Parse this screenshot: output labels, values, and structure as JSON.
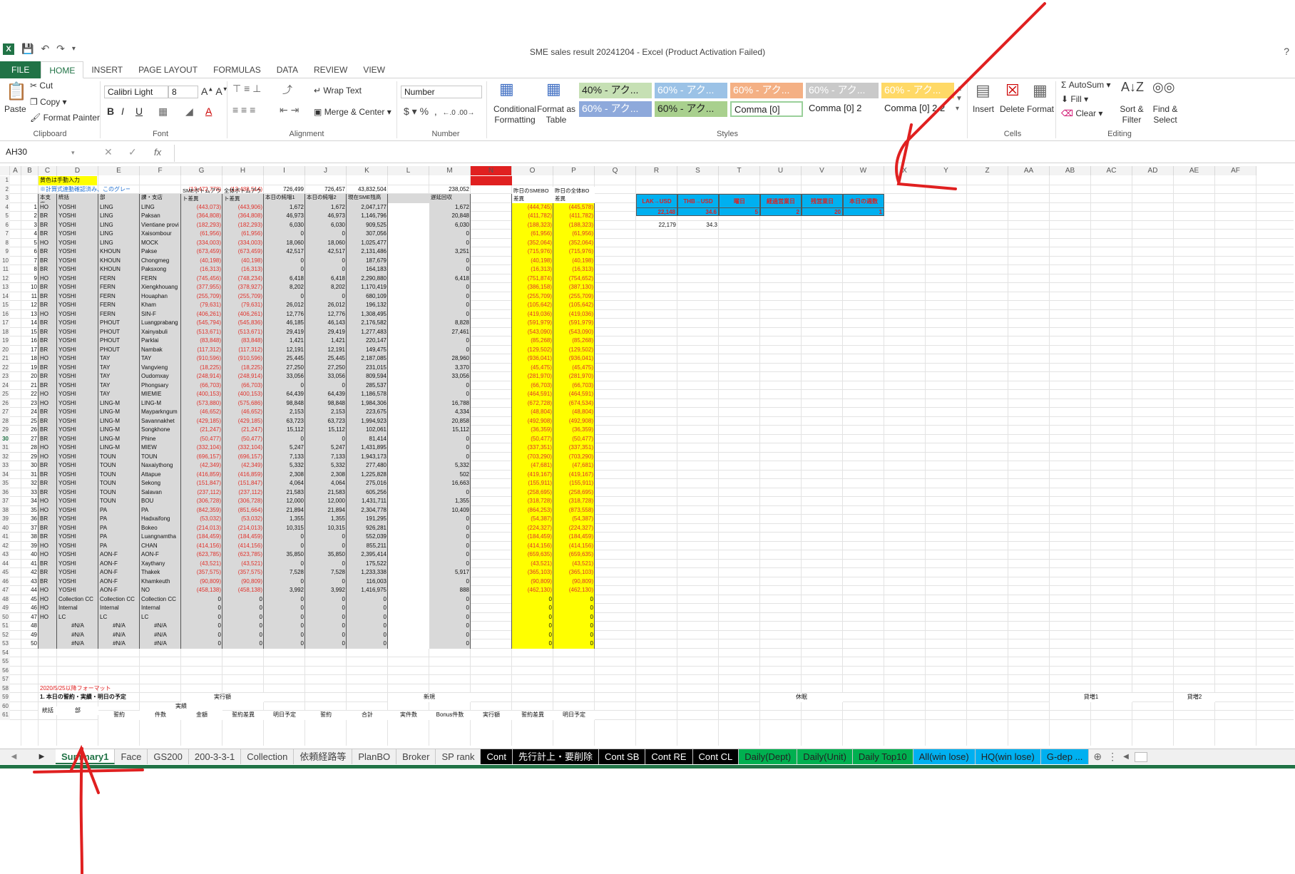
{
  "window": {
    "title": "SME sales result 20241204 - Excel (Product Activation Failed)",
    "help": "?"
  },
  "ribbon_tabs": [
    "FILE",
    "HOME",
    "INSERT",
    "PAGE LAYOUT",
    "FORMULAS",
    "DATA",
    "REVIEW",
    "VIEW"
  ],
  "clipboard": {
    "paste": "Paste",
    "cut": "Cut",
    "copy": "Copy",
    "format_painter": "Format Painter",
    "label": "Clipboard"
  },
  "font": {
    "name": "Calibri Light",
    "size": "8",
    "label": "Font"
  },
  "alignment": {
    "wrap": "Wrap Text",
    "merge": "Merge & Center",
    "label": "Alignment"
  },
  "number": {
    "format": "Number",
    "label": "Number"
  },
  "styles": {
    "conditional": "Conditional Formatting",
    "format_table": "Format as Table",
    "label": "Styles",
    "cells": [
      {
        "text": "40% - アク...",
        "bg": "#c6e0b4"
      },
      {
        "text": "60% - アク...",
        "bg": "#9bc2e6"
      },
      {
        "text": "60% - アク...",
        "bg": "#f4b084"
      },
      {
        "text": "60% - アク...",
        "bg": "#c9c9c9"
      },
      {
        "text": "60% - アク...",
        "bg": "#ffd966"
      },
      {
        "text": "60% - アク...",
        "bg": "#8ea9db"
      },
      {
        "text": "60% - アク...",
        "bg": "#a9d08e"
      },
      {
        "text": "Comma [0]",
        "bg": "#ffffff"
      },
      {
        "text": "Comma [0] 2",
        "bg": "#ffffff"
      },
      {
        "text": "Comma [0] 2 2",
        "bg": "#ffffff"
      }
    ]
  },
  "cells_group": {
    "insert": "Insert",
    "delete": "Delete",
    "format": "Format",
    "label": "Cells"
  },
  "editing": {
    "autosum": "AutoSum",
    "fill": "Fill",
    "clear": "Clear",
    "sort": "Sort & Filter",
    "find": "Find & Select",
    "label": "Editing"
  },
  "formula_bar": {
    "name_box": "AH30",
    "fx": "fx",
    "content": ""
  },
  "columns": [
    "A",
    "B",
    "C",
    "D",
    "E",
    "F",
    "G",
    "H",
    "I",
    "J",
    "K",
    "L",
    "M",
    "N",
    "O",
    "P",
    "Q",
    "R",
    "S",
    "T",
    "U",
    "V",
    "W",
    "X",
    "Y",
    "Z",
    "AA",
    "AB",
    "AC",
    "AD",
    "AE",
    "AF"
  ],
  "sheet": {
    "r1_note": "黄色は手動入力",
    "r2_note": "※計算式連動確認済み、このグレー部分はいつ削除して",
    "r2_vals": {
      "G": "(13,472,778)",
      "H": "(13,488,514)",
      "I": "726,499",
      "J": "726,457",
      "K": "43,832,504",
      "M": "238,052",
      "O": "(14,199,276)",
      "P": "(14,214,970)"
    },
    "headers": {
      "C": "本支店",
      "D": "統括",
      "E": "部",
      "F": "課・支店",
      "G": "SMEボトムアウト差異",
      "H": "全体ボトムアウト差異",
      "I": "本日の純増1",
      "J": "本日の純増2",
      "K": "現在SME残高",
      "M": "遅延回収",
      "O": "昨日のSMEBO差異",
      "P": "昨日の全体BO差異"
    },
    "kpi_headers": [
      "LAK→USD",
      "THB→USD",
      "曜日",
      "経過営業日",
      "残営業日",
      "本日の週数"
    ],
    "kpi_values": [
      "22,148",
      "34.6",
      "5",
      "2",
      "20",
      "1"
    ],
    "r6_vals": [
      "22,179",
      "34.3"
    ],
    "rows": [
      [
        "1",
        "HO",
        "YOSHI",
        "LING",
        "LING",
        "(443,073)",
        "(443,906)",
        "1,672",
        "1,672",
        "2,047,177",
        "1,672",
        "(444,745)",
        "(445,578)"
      ],
      [
        "2",
        "BR",
        "YOSHI",
        "LING",
        "Paksan",
        "(364,808)",
        "(364,808)",
        "46,973",
        "46,973",
        "1,146,796",
        "20,848",
        "(411,782)",
        "(411,782)"
      ],
      [
        "3",
        "BR",
        "YOSHI",
        "LING",
        "Vientiane provi",
        "(182,293)",
        "(182,293)",
        "6,030",
        "6,030",
        "909,525",
        "6,030",
        "(188,323)",
        "(188,323)"
      ],
      [
        "4",
        "BR",
        "YOSHI",
        "LING",
        "Xaisombour",
        "(61,956)",
        "(61,956)",
        "0",
        "0",
        "307,056",
        "0",
        "(61,956)",
        "(61,956)"
      ],
      [
        "5",
        "HO",
        "YOSHI",
        "LING",
        "MOCK",
        "(334,003)",
        "(334,003)",
        "18,060",
        "18,060",
        "1,025,477",
        "0",
        "(352,064)",
        "(352,064)"
      ],
      [
        "6",
        "BR",
        "YOSHI",
        "KHOUN",
        "Pakse",
        "(673,459)",
        "(673,459)",
        "42,517",
        "42,517",
        "2,131,486",
        "3,251",
        "(715,976)",
        "(715,976)"
      ],
      [
        "7",
        "BR",
        "YOSHI",
        "KHOUN",
        "Chongmeg",
        "(40,198)",
        "(40,198)",
        "0",
        "0",
        "187,679",
        "0",
        "(40,198)",
        "(40,198)"
      ],
      [
        "8",
        "BR",
        "YOSHI",
        "KHOUN",
        "Paksxong",
        "(16,313)",
        "(16,313)",
        "0",
        "0",
        "164,183",
        "0",
        "(16,313)",
        "(16,313)"
      ],
      [
        "9",
        "HO",
        "YOSHI",
        "FERN",
        "FERN",
        "(745,456)",
        "(748,234)",
        "6,418",
        "6,418",
        "2,290,880",
        "6,418",
        "(751,874)",
        "(754,652)"
      ],
      [
        "10",
        "BR",
        "YOSHI",
        "FERN",
        "Xiengkhouang",
        "(377,955)",
        "(378,927)",
        "8,202",
        "8,202",
        "1,170,419",
        "0",
        "(386,158)",
        "(387,130)"
      ],
      [
        "11",
        "BR",
        "YOSHI",
        "FERN",
        "Houaphan",
        "(255,709)",
        "(255,709)",
        "0",
        "0",
        "680,109",
        "0",
        "(255,709)",
        "(255,709)"
      ],
      [
        "12",
        "BR",
        "YOSHI",
        "FERN",
        "Kham",
        "(79,631)",
        "(79,631)",
        "26,012",
        "26,012",
        "196,132",
        "0",
        "(105,642)",
        "(105,642)"
      ],
      [
        "13",
        "HO",
        "YOSHI",
        "FERN",
        "SIN-F",
        "(406,261)",
        "(406,261)",
        "12,776",
        "12,776",
        "1,308,495",
        "0",
        "(419,036)",
        "(419,036)"
      ],
      [
        "14",
        "BR",
        "YOSHI",
        "PHOUT",
        "Luangprabang",
        "(545,794)",
        "(545,836)",
        "46,185",
        "46,143",
        "2,176,582",
        "8,828",
        "(591,979)",
        "(591,979)"
      ],
      [
        "15",
        "BR",
        "YOSHI",
        "PHOUT",
        "Xainyabuli",
        "(513,671)",
        "(513,671)",
        "29,419",
        "29,419",
        "1,277,483",
        "27,461",
        "(543,090)",
        "(543,090)"
      ],
      [
        "16",
        "BR",
        "YOSHI",
        "PHOUT",
        "Parklai",
        "(83,848)",
        "(83,848)",
        "1,421",
        "1,421",
        "220,147",
        "0",
        "(85,268)",
        "(85,268)"
      ],
      [
        "17",
        "BR",
        "YOSHI",
        "PHOUT",
        "Nambak",
        "(117,312)",
        "(117,312)",
        "12,191",
        "12,191",
        "149,475",
        "0",
        "(129,502)",
        "(129,502)"
      ],
      [
        "18",
        "HO",
        "YOSHI",
        "TAY",
        "TAY",
        "(910,596)",
        "(910,596)",
        "25,445",
        "25,445",
        "2,187,085",
        "28,960",
        "(936,041)",
        "(936,041)"
      ],
      [
        "19",
        "BR",
        "YOSHI",
        "TAY",
        "Vangvieng",
        "(18,225)",
        "(18,225)",
        "27,250",
        "27,250",
        "231,015",
        "3,370",
        "(45,475)",
        "(45,475)"
      ],
      [
        "20",
        "BR",
        "YOSHI",
        "TAY",
        "Oudomxay",
        "(248,914)",
        "(248,914)",
        "33,056",
        "33,056",
        "809,594",
        "33,056",
        "(281,970)",
        "(281,970)"
      ],
      [
        "21",
        "BR",
        "YOSHI",
        "TAY",
        "Phongsary",
        "(66,703)",
        "(66,703)",
        "0",
        "0",
        "285,537",
        "0",
        "(66,703)",
        "(66,703)"
      ],
      [
        "22",
        "HO",
        "YOSHI",
        "TAY",
        "MIEMIE",
        "(400,153)",
        "(400,153)",
        "64,439",
        "64,439",
        "1,186,578",
        "0",
        "(464,591)",
        "(464,591)"
      ],
      [
        "23",
        "HO",
        "YOSHI",
        "LING-M",
        "LING-M",
        "(573,880)",
        "(575,686)",
        "98,848",
        "98,848",
        "1,984,306",
        "16,788",
        "(672,728)",
        "(674,534)"
      ],
      [
        "24",
        "BR",
        "YOSHI",
        "LING-M",
        "Mayparkngum",
        "(46,652)",
        "(46,652)",
        "2,153",
        "2,153",
        "223,675",
        "4,334",
        "(48,804)",
        "(48,804)"
      ],
      [
        "25",
        "BR",
        "YOSHI",
        "LING-M",
        "Savannakhet",
        "(429,185)",
        "(429,185)",
        "63,723",
        "63,723",
        "1,994,923",
        "20,858",
        "(492,908)",
        "(492,908)"
      ],
      [
        "26",
        "BR",
        "YOSHI",
        "LING-M",
        "Songkhone",
        "(21,247)",
        "(21,247)",
        "15,112",
        "15,112",
        "102,061",
        "15,112",
        "(36,359)",
        "(36,359)"
      ],
      [
        "27",
        "BR",
        "YOSHI",
        "LING-M",
        "Phine",
        "(50,477)",
        "(50,477)",
        "0",
        "0",
        "81,414",
        "0",
        "(50,477)",
        "(50,477)"
      ],
      [
        "28",
        "HO",
        "YOSHI",
        "LING-M",
        "MIEW",
        "(332,104)",
        "(332,104)",
        "5,247",
        "5,247",
        "1,431,895",
        "0",
        "(337,351)",
        "(337,351)"
      ],
      [
        "29",
        "HO",
        "YOSHI",
        "TOUN",
        "TOUN",
        "(696,157)",
        "(696,157)",
        "7,133",
        "7,133",
        "1,943,173",
        "0",
        "(703,290)",
        "(703,290)"
      ],
      [
        "30",
        "BR",
        "YOSHI",
        "TOUN",
        "Naxaiythong",
        "(42,349)",
        "(42,349)",
        "5,332",
        "5,332",
        "277,480",
        "5,332",
        "(47,681)",
        "(47,681)"
      ],
      [
        "31",
        "BR",
        "YOSHI",
        "TOUN",
        "Attapue",
        "(416,859)",
        "(416,859)",
        "2,308",
        "2,308",
        "1,225,828",
        "502",
        "(419,167)",
        "(419,167)"
      ],
      [
        "32",
        "BR",
        "YOSHI",
        "TOUN",
        "Sekong",
        "(151,847)",
        "(151,847)",
        "4,064",
        "4,064",
        "275,016",
        "16,663",
        "(155,911)",
        "(155,911)"
      ],
      [
        "33",
        "BR",
        "YOSHI",
        "TOUN",
        "Salavan",
        "(237,112)",
        "(237,112)",
        "21,583",
        "21,583",
        "605,256",
        "0",
        "(258,695)",
        "(258,695)"
      ],
      [
        "34",
        "HO",
        "YOSHI",
        "TOUN",
        "BOU",
        "(306,728)",
        "(306,728)",
        "12,000",
        "12,000",
        "1,431,711",
        "1,355",
        "(318,728)",
        "(318,728)"
      ],
      [
        "35",
        "HO",
        "YOSHI",
        "PA",
        "PA",
        "(842,359)",
        "(851,664)",
        "21,894",
        "21,894",
        "2,304,778",
        "10,409",
        "(864,253)",
        "(873,558)"
      ],
      [
        "36",
        "BR",
        "YOSHI",
        "PA",
        "Hadxaifong",
        "(53,032)",
        "(53,032)",
        "1,355",
        "1,355",
        "191,295",
        "0",
        "(54,387)",
        "(54,387)"
      ],
      [
        "37",
        "BR",
        "YOSHI",
        "PA",
        "Bokeo",
        "(214,013)",
        "(214,013)",
        "10,315",
        "10,315",
        "926,281",
        "0",
        "(224,327)",
        "(224,327)"
      ],
      [
        "38",
        "BR",
        "YOSHI",
        "PA",
        "Luangnamtha",
        "(184,459)",
        "(184,459)",
        "0",
        "0",
        "552,039",
        "0",
        "(184,459)",
        "(184,459)"
      ],
      [
        "39",
        "HO",
        "YOSHI",
        "PA",
        "CHAN",
        "(414,156)",
        "(414,156)",
        "0",
        "0",
        "855,211",
        "0",
        "(414,156)",
        "(414,156)"
      ],
      [
        "40",
        "HO",
        "YOSHI",
        "AON-F",
        "AON-F",
        "(623,785)",
        "(623,785)",
        "35,850",
        "35,850",
        "2,395,414",
        "0",
        "(659,635)",
        "(659,635)"
      ],
      [
        "41",
        "BR",
        "YOSHI",
        "AON-F",
        "Xaythany",
        "(43,521)",
        "(43,521)",
        "0",
        "0",
        "175,522",
        "0",
        "(43,521)",
        "(43,521)"
      ],
      [
        "42",
        "BR",
        "YOSHI",
        "AON-F",
        "Thakek",
        "(357,575)",
        "(357,575)",
        "7,528",
        "7,528",
        "1,233,338",
        "5,917",
        "(365,103)",
        "(365,103)"
      ],
      [
        "43",
        "BR",
        "YOSHI",
        "AON-F",
        "Khamkeuth",
        "(90,809)",
        "(90,809)",
        "0",
        "0",
        "116,003",
        "0",
        "(90,809)",
        "(90,809)"
      ],
      [
        "44",
        "HO",
        "YOSHI",
        "AON-F",
        "NO",
        "(458,138)",
        "(458,138)",
        "3,992",
        "3,992",
        "1,416,975",
        "888",
        "(462,130)",
        "(462,130)"
      ],
      [
        "45",
        "HO",
        "Collection CC",
        "Collection CC",
        "Collection CC",
        "0",
        "0",
        "0",
        "0",
        "0",
        "0",
        "0",
        "0"
      ],
      [
        "46",
        "HO",
        "Internal",
        "Internal",
        "Internal",
        "0",
        "0",
        "0",
        "0",
        "0",
        "0",
        "0",
        "0"
      ],
      [
        "47",
        "HO",
        "LC",
        "LC",
        "LC",
        "0",
        "0",
        "0",
        "0",
        "0",
        "0",
        "0",
        "0"
      ],
      [
        "48",
        "",
        "#N/A",
        "#N/A",
        "#N/A",
        "0",
        "0",
        "0",
        "0",
        "0",
        "0",
        "0",
        "0"
      ],
      [
        "49",
        "",
        "#N/A",
        "#N/A",
        "#N/A",
        "0",
        "0",
        "0",
        "0",
        "0",
        "0",
        "0",
        "0"
      ],
      [
        "50",
        "",
        "#N/A",
        "#N/A",
        "#N/A",
        "0",
        "0",
        "0",
        "0",
        "0",
        "0",
        "0",
        "0"
      ]
    ],
    "r58_note": "2020/5/25以降フォーマット",
    "r59_title": "1. 本日の誓約・実績・明日の予定",
    "lower_headers": {
      "c1": "統括",
      "c2": "部",
      "jisseki_gaku": "実行額",
      "shinki": "新規",
      "kyumin": "休眠",
      "zoka1": "貸増1",
      "zoka2": "貸増2",
      "jisseki": "実績",
      "seiyaku": "誓約",
      "kensu": "件数",
      "kingaku": "金額",
      "seiyaku_sai": "誓約差異",
      "asu_yotei": "明日予定",
      "gokei": "合計",
      "jitsu_kensu": "実件数",
      "bonus_kensu": "Bonus件数",
      "jikko_gaku": "実行額"
    }
  },
  "sheet_tabs": [
    {
      "name": "Summary1",
      "active": true,
      "bg": "",
      "fg": "#217346"
    },
    {
      "name": "Face",
      "bg": "",
      "fg": "#444"
    },
    {
      "name": "GS200",
      "bg": "",
      "fg": "#444"
    },
    {
      "name": "200-3-3-1",
      "bg": "",
      "fg": "#444"
    },
    {
      "name": "Collection",
      "bg": "",
      "fg": "#444"
    },
    {
      "name": "依頼経路等",
      "bg": "",
      "fg": "#444"
    },
    {
      "name": "PlanBO",
      "bg": "",
      "fg": "#444"
    },
    {
      "name": "Broker",
      "bg": "",
      "fg": "#444"
    },
    {
      "name": "SP rank",
      "bg": "",
      "fg": "#444"
    },
    {
      "name": "Cont",
      "bg": "#000000",
      "fg": "#ffffff"
    },
    {
      "name": "先行計上・要削除",
      "bg": "#000000",
      "fg": "#ffffff"
    },
    {
      "name": "Cont SB",
      "bg": "#000000",
      "fg": "#ffffff"
    },
    {
      "name": "Cont RE",
      "bg": "#000000",
      "fg": "#ffffff"
    },
    {
      "name": "Cont CL",
      "bg": "#000000",
      "fg": "#ffffff"
    },
    {
      "name": "Daily(Dept)",
      "bg": "#00b050",
      "fg": "#222"
    },
    {
      "name": "Daily(Unit)",
      "bg": "#00b050",
      "fg": "#222"
    },
    {
      "name": "Daily Top10",
      "bg": "#00b050",
      "fg": "#222"
    },
    {
      "name": "All(win lose)",
      "bg": "#00b0f0",
      "fg": "#222"
    },
    {
      "name": "HQ(win lose)",
      "bg": "#00b0f0",
      "fg": "#222"
    },
    {
      "name": "G-dep ...",
      "bg": "#00b0f0",
      "fg": "#222"
    }
  ],
  "annotation_colors": {
    "pen": "#e02020"
  }
}
